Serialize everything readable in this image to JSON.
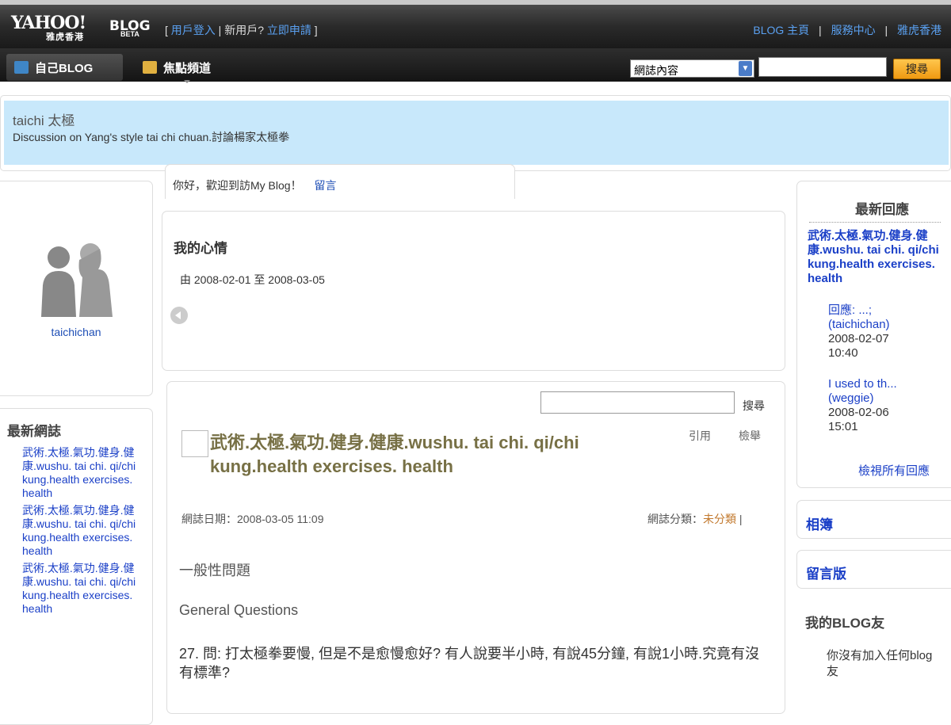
{
  "topbar": {
    "logo": "YAHOO!",
    "logo_region": "雅虎香港",
    "logo_blog": "BLOG",
    "logo_beta": "BETA",
    "auth_open": "[",
    "login": "用戶登入",
    "auth_sep": "|",
    "new_user": "新用戶?",
    "signup": "立即申請",
    "auth_close": "]",
    "nav": [
      "BLOG 主頁",
      "服務中心",
      "雅虎香港"
    ],
    "nav_sep": "|",
    "tabs": {
      "my_blog": "自己BLOG",
      "focus": "焦點頻道"
    },
    "search_scope": "網誌內容",
    "search_button": "搜尋"
  },
  "blog": {
    "title": "taichi 太極",
    "description": "Discussion on Yang's style tai chi chuan.討論楊家太極拳"
  },
  "welcome": {
    "text": "你好，歡迎到訪My Blog！",
    "guestbook": "留言"
  },
  "profile": {
    "name": "taichichan"
  },
  "mood": {
    "title": "我的心情",
    "range": "由 2008-02-01 至 2008-03-05"
  },
  "left_latest": {
    "title": "最新網誌",
    "items": [
      "武術.太極.氣功.健身.健康.wushu. tai chi. qi/chi kung.health exercises. health",
      "武術.太極.氣功.健身.健康.wushu. tai chi. qi/chi kung.health exercises. health",
      "武術.太極.氣功.健身.健康.wushu. tai chi. qi/chi kung.health exercises. health"
    ]
  },
  "post": {
    "search_button": "搜尋",
    "quote": "引用",
    "report": "檢舉",
    "title": "武術.太極.氣功.健身.健康.wushu. tai chi. qi/chi kung.health exercises. health",
    "date_label": "網誌日期：2008-03-05 11:09",
    "category_label": "網誌分類：",
    "category_value": "未分類",
    "category_sep": "|",
    "body": [
      "一般性問題",
      "General Questions",
      "27. 問: 打太極拳要慢, 但是不是愈慢愈好? 有人說要半小時, 有說45分鐘, 有說1小時.究竟有沒有標準?"
    ]
  },
  "right": {
    "latest_replies_title": "最新回應",
    "post_title": "武術.太極.氣功.健身.健康.wushu. tai chi. qi/chi kung.health exercises. health",
    "replies": [
      {
        "text": "回應: ...;",
        "author": "(taichichan)",
        "date": "2008-02-07",
        "time": "10:40"
      },
      {
        "text": "I used to th...",
        "author": "(weggie)",
        "date": "2008-02-06",
        "time": "15:01"
      }
    ],
    "view_all": "檢視所有回應",
    "album": "相簿",
    "guestbook": "留言版",
    "friends_title": "我的BLOG友",
    "friends_none": "你沒有加入任何blog友"
  }
}
